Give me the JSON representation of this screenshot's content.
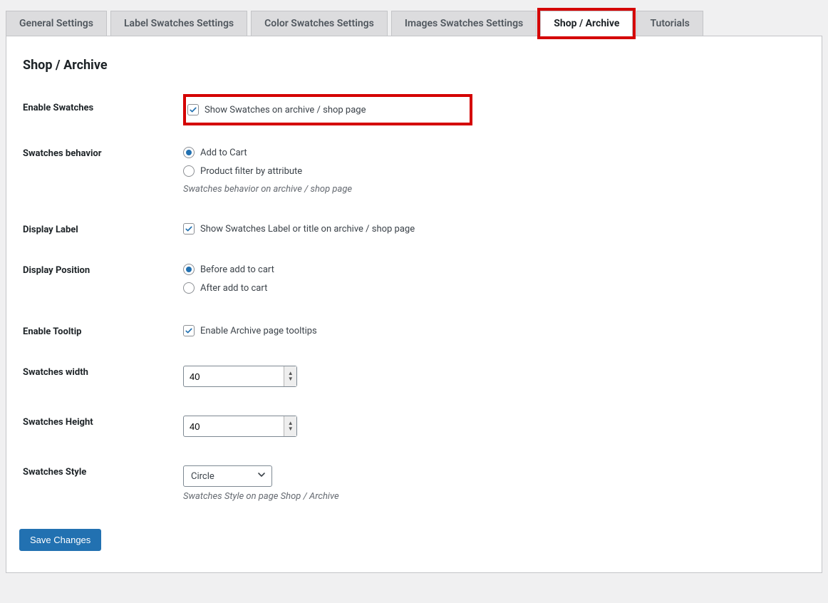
{
  "tabs": [
    {
      "label": "General Settings"
    },
    {
      "label": "Label Swatches Settings"
    },
    {
      "label": "Color Swatches Settings"
    },
    {
      "label": "Images Swatches Settings"
    },
    {
      "label": "Shop / Archive",
      "active": true
    },
    {
      "label": "Tutorials"
    }
  ],
  "page": {
    "heading": "Shop / Archive"
  },
  "fields": {
    "enable_swatches": {
      "label": "Enable Swatches",
      "checkbox_label": "Show Swatches on archive / shop page"
    },
    "swatches_behavior": {
      "label": "Swatches behavior",
      "options": {
        "add_to_cart": "Add to Cart",
        "product_filter": "Product filter by attribute"
      },
      "desc": "Swatches behavior on archive / shop page"
    },
    "display_label": {
      "label": "Display Label",
      "checkbox_label": "Show Swatches Label or title on archive / shop page"
    },
    "display_position": {
      "label": "Display Position",
      "options": {
        "before": "Before add to cart",
        "after": "After add to cart"
      }
    },
    "enable_tooltip": {
      "label": "Enable Tooltip",
      "checkbox_label": "Enable Archive page tooltips"
    },
    "swatches_width": {
      "label": "Swatches width",
      "value": "40"
    },
    "swatches_height": {
      "label": "Swatches Height",
      "value": "40"
    },
    "swatches_style": {
      "label": "Swatches Style",
      "selected": "Circle",
      "desc": "Swatches Style on page Shop / Archive"
    }
  },
  "buttons": {
    "save": "Save Changes"
  }
}
